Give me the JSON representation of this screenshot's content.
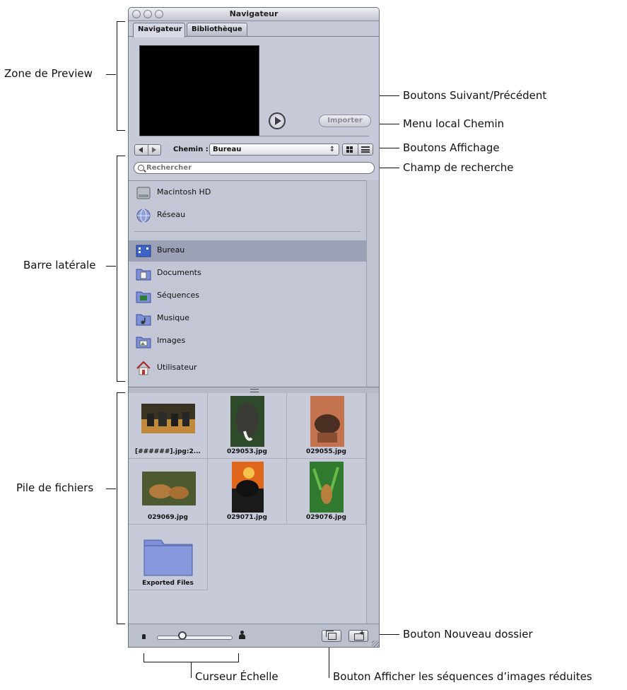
{
  "window": {
    "title": "Navigateur",
    "tabs": [
      {
        "label": "Navigateur",
        "active": true
      },
      {
        "label": "Bibliothèque",
        "active": false
      }
    ]
  },
  "preview": {
    "importer_label": "Importer"
  },
  "path_bar": {
    "label": "Chemin :",
    "value": "Bureau"
  },
  "search": {
    "placeholder": "Rechercher"
  },
  "sidebar": {
    "volumes": [
      {
        "label": "Macintosh HD",
        "icon": "hard-drive-icon"
      },
      {
        "label": "Réseau",
        "icon": "network-globe-icon"
      }
    ],
    "places": [
      {
        "label": "Bureau",
        "icon": "desktop-folder-icon",
        "selected": true
      },
      {
        "label": "Documents",
        "icon": "documents-folder-icon"
      },
      {
        "label": "Séquences",
        "icon": "movies-folder-icon"
      },
      {
        "label": "Musique",
        "icon": "music-folder-icon"
      },
      {
        "label": "Images",
        "icon": "pictures-folder-icon"
      },
      {
        "label": "Utilisateur",
        "icon": "home-icon"
      }
    ]
  },
  "files": [
    {
      "name": "[######].jpg:2...",
      "type": "image-sequence"
    },
    {
      "name": "029053.jpg",
      "type": "image"
    },
    {
      "name": "029055.jpg",
      "type": "image"
    },
    {
      "name": "029069.jpg",
      "type": "image"
    },
    {
      "name": "029071.jpg",
      "type": "image"
    },
    {
      "name": "029076.jpg",
      "type": "image"
    },
    {
      "name": "Exported Files",
      "type": "folder"
    }
  ],
  "annotations": {
    "zone_preview": "Zone de Preview",
    "boutons_suivant": "Boutons Suivant/Précédent",
    "menu_chemin": "Menu local Chemin",
    "boutons_affichage": "Boutons Affichage",
    "champ_recherche": "Champ de recherche",
    "barre_laterale": "Barre latérale",
    "pile_fichiers": "Pile de fichiers",
    "bouton_nouveau_dossier": "Bouton Nouveau dossier",
    "curseur_echelle": "Curseur Échelle",
    "bouton_sequences": "Bouton Afficher les séquences d’images réduites"
  },
  "colors": {
    "window_bg": "#c6cad9",
    "selection": "#9ca1b5",
    "folder_blue": "#7d8fd6"
  }
}
